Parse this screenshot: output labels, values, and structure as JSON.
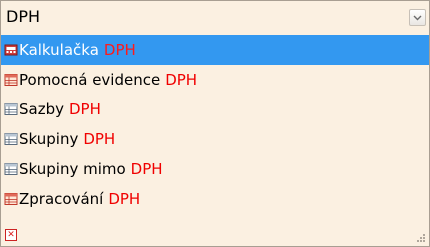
{
  "search": {
    "value": "DPH"
  },
  "dropdown": {
    "icon": "chevron-down-icon"
  },
  "items": [
    {
      "label": "Kalkulačka",
      "highlight": "DPH",
      "icon": "calculator-icon",
      "selected": true
    },
    {
      "label": "Pomocná evidence",
      "highlight": "DPH",
      "icon": "table-icon",
      "selected": false
    },
    {
      "label": "Sazby",
      "highlight": "DPH",
      "icon": "table-icon",
      "selected": false
    },
    {
      "label": "Skupiny",
      "highlight": "DPH",
      "icon": "table-icon",
      "selected": false
    },
    {
      "label": "Skupiny mimo",
      "highlight": "DPH",
      "icon": "table-icon",
      "selected": false
    },
    {
      "label": "Zpracování",
      "highlight": "DPH",
      "icon": "table-icon",
      "selected": false
    }
  ],
  "footer": {
    "clear_icon": "close-icon",
    "resize_icon": "resize-grip-icon"
  },
  "colors": {
    "selection": "#3398f0",
    "highlight": "#f00000",
    "background": "#fbf0e1"
  }
}
